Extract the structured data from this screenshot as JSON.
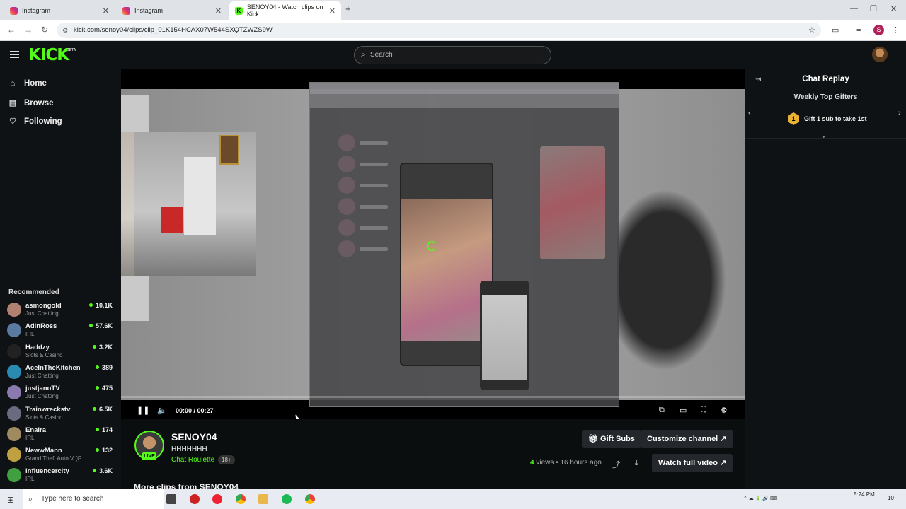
{
  "browser": {
    "tabs": [
      {
        "label": "Instagram",
        "active": false
      },
      {
        "label": "Instagram",
        "active": false
      },
      {
        "label": "SENOY04 - Watch clips on Kick",
        "active": true
      }
    ],
    "url": "kick.com/senoy04/clips/clip_01K154HCAX07W544SXQTZWZS9W",
    "profile_initial": "S"
  },
  "kick": {
    "logo": "KICK",
    "beta": "BETA",
    "search_placeholder": "Search",
    "nav": [
      {
        "label": "Home",
        "icon": "home-icon"
      },
      {
        "label": "Browse",
        "icon": "browse-icon"
      },
      {
        "label": "Following",
        "icon": "heart-icon"
      }
    ],
    "recommended_title": "Recommended",
    "recommended": [
      {
        "name": "asmongold",
        "category": "Just Chatting",
        "viewers": "10.1K",
        "color": "#b08070"
      },
      {
        "name": "AdinRoss",
        "category": "IRL",
        "viewers": "57.6K",
        "color": "#5a7aa0"
      },
      {
        "name": "Haddzy",
        "category": "Slots & Casino",
        "viewers": "3.2K",
        "color": "#222222"
      },
      {
        "name": "AceInTheKitchen",
        "category": "Just Chatting",
        "viewers": "389",
        "color": "#2a8ab0"
      },
      {
        "name": "justjanoTV",
        "category": "Just Chatting",
        "viewers": "475",
        "color": "#8a7ab0"
      },
      {
        "name": "Trainwreckstv",
        "category": "Slots & Casino",
        "viewers": "6.5K",
        "color": "#6a6a80"
      },
      {
        "name": "Enaira",
        "category": "IRL",
        "viewers": "174",
        "color": "#a08a60"
      },
      {
        "name": "NewwMann",
        "category": "Grand Theft Auto V (G...",
        "viewers": "132",
        "color": "#c0a040"
      },
      {
        "name": "influencercity",
        "category": "IRL",
        "viewers": "3.6K",
        "color": "#40a040"
      }
    ]
  },
  "player": {
    "time": "00:00 / 00:27",
    "progress": 0.0
  },
  "channel": {
    "name": "SENOY04",
    "title": "HHHHHHH",
    "category": "Chat Roulette",
    "age": "18+",
    "live": "LIVE",
    "gift_subs": "Gift Subs",
    "customize": "Customize channel",
    "views_count": "4",
    "views_label": "views",
    "posted": "16 hours ago",
    "watch_full": "Watch full video",
    "more_clips": "More clips from SENOY04"
  },
  "chat": {
    "title": "Chat Replay",
    "gifters_title": "Weekly Top Gifters",
    "rank": "1",
    "gift_cta": "Gift 1 sub to take 1st"
  },
  "taskbar": {
    "search_placeholder": "Type here to search",
    "time": "5:24 PM",
    "notifications": "10"
  }
}
